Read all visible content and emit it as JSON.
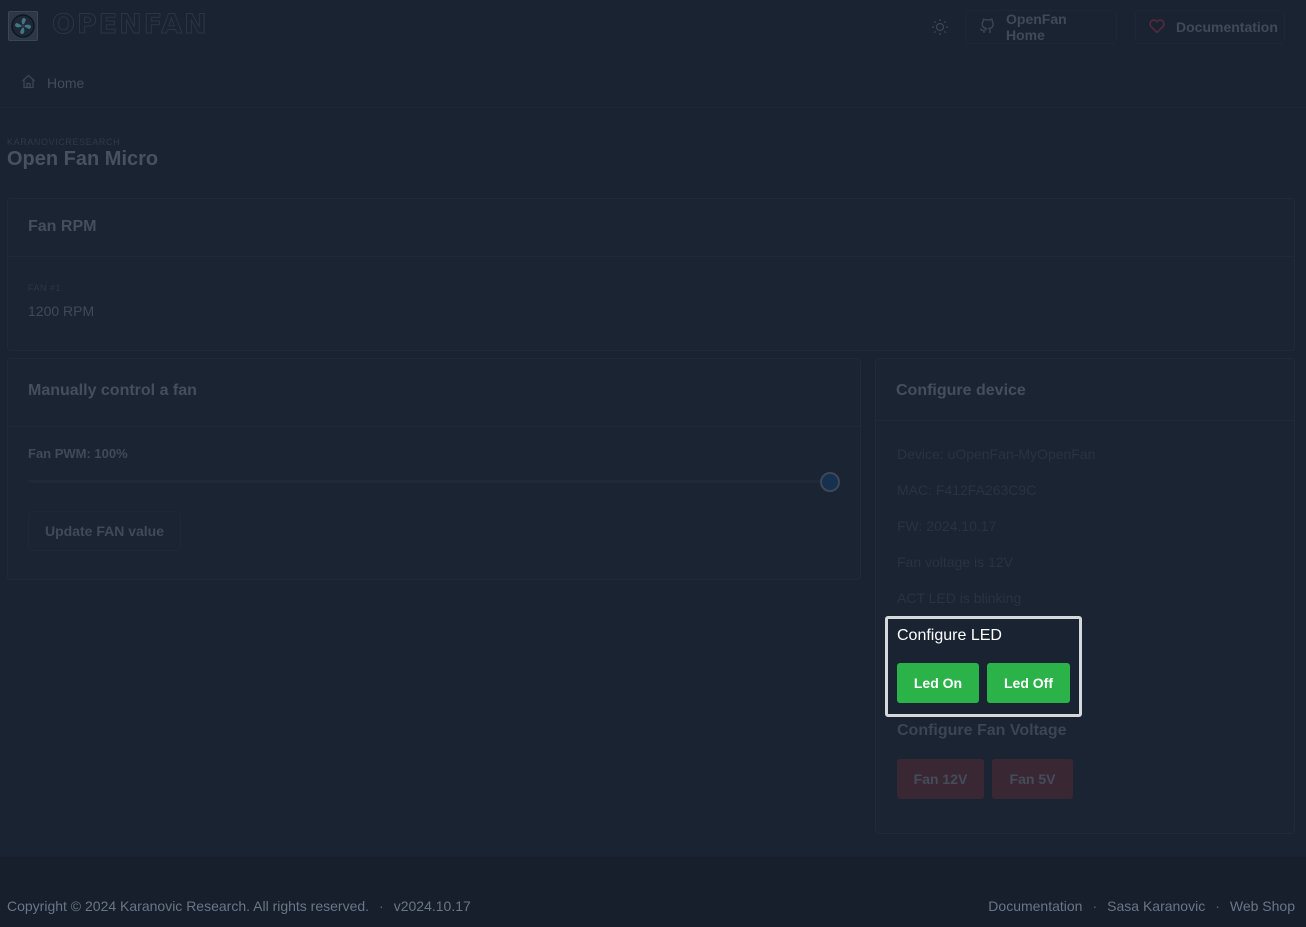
{
  "header": {
    "brand": "OPENFAN",
    "logo_icon": "fan-icon",
    "theme_icon": "sun-icon",
    "nav": [
      {
        "label": "OpenFan Home",
        "icon": "github-icon"
      },
      {
        "label": "Documentation",
        "icon": "heart-icon"
      }
    ]
  },
  "breadcrumb": {
    "icon": "home-icon",
    "label": "Home"
  },
  "page": {
    "org": "KARANOVICRESEARCH",
    "title": "Open Fan Micro"
  },
  "rpm_card": {
    "title": "Fan RPM",
    "fans": [
      {
        "label": "FAN #1",
        "value": "1200 RPM"
      }
    ]
  },
  "manual_card": {
    "title": "Manually control a fan",
    "pwm_label": "Fan PWM: 100%",
    "pwm_percent": 100,
    "update_button": "Update FAN value"
  },
  "config_card": {
    "title": "Configure device",
    "info": [
      "Device: uOpenFan-MyOpenFan",
      "MAC: F412FA263C9C",
      "FW: 2024.10.17",
      "Fan voltage is 12V",
      "ACT LED is blinking"
    ],
    "led": {
      "title": "Configure LED",
      "on_label": "Led On",
      "off_label": "Led Off"
    },
    "voltage": {
      "title": "Configure Fan Voltage",
      "v12_label": "Fan 12V",
      "v5_label": "Fan 5V"
    }
  },
  "colors": {
    "green": "#2bb34a",
    "background": "#1a2332",
    "footer": "#161f2b"
  },
  "footer": {
    "copyright": "Copyright © 2024 Karanovic Research. All rights reserved.",
    "separator": "·",
    "version": "v2024.10.17",
    "links": [
      "Documentation",
      "Sasa Karanovic",
      "Web Shop"
    ]
  }
}
